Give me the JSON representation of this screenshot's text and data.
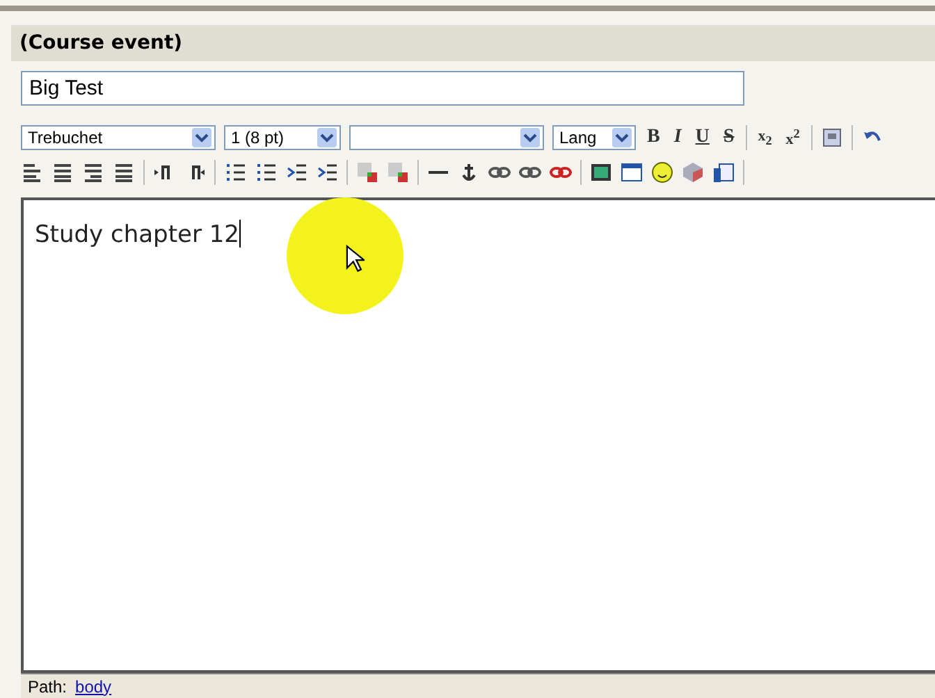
{
  "section_title": "(Course event)",
  "name_field": {
    "value": "Big Test"
  },
  "selects": [
    {
      "kind": "dropdown",
      "value": "Trebuchet"
    },
    {
      "kind": "dropdown",
      "value": "1 (8 pt)"
    },
    {
      "kind": "dropdown"
    },
    {
      "kind": "dropdown",
      "value": "Lang"
    }
  ],
  "format_buttons": [
    {
      "kind": "bold",
      "label": "B"
    },
    {
      "kind": "italic",
      "label": "I"
    },
    {
      "kind": "underline",
      "label": "U"
    },
    {
      "kind": "strike",
      "label": "S"
    },
    {
      "kind": "sep"
    },
    {
      "kind": "sub",
      "label": "x",
      "sup": "2"
    },
    {
      "kind": "super",
      "label": "x",
      "sup": "2"
    }
  ],
  "editor": {
    "text": "Study chapter 12"
  },
  "path_bar": {
    "label": "Path:",
    "link": "body"
  }
}
